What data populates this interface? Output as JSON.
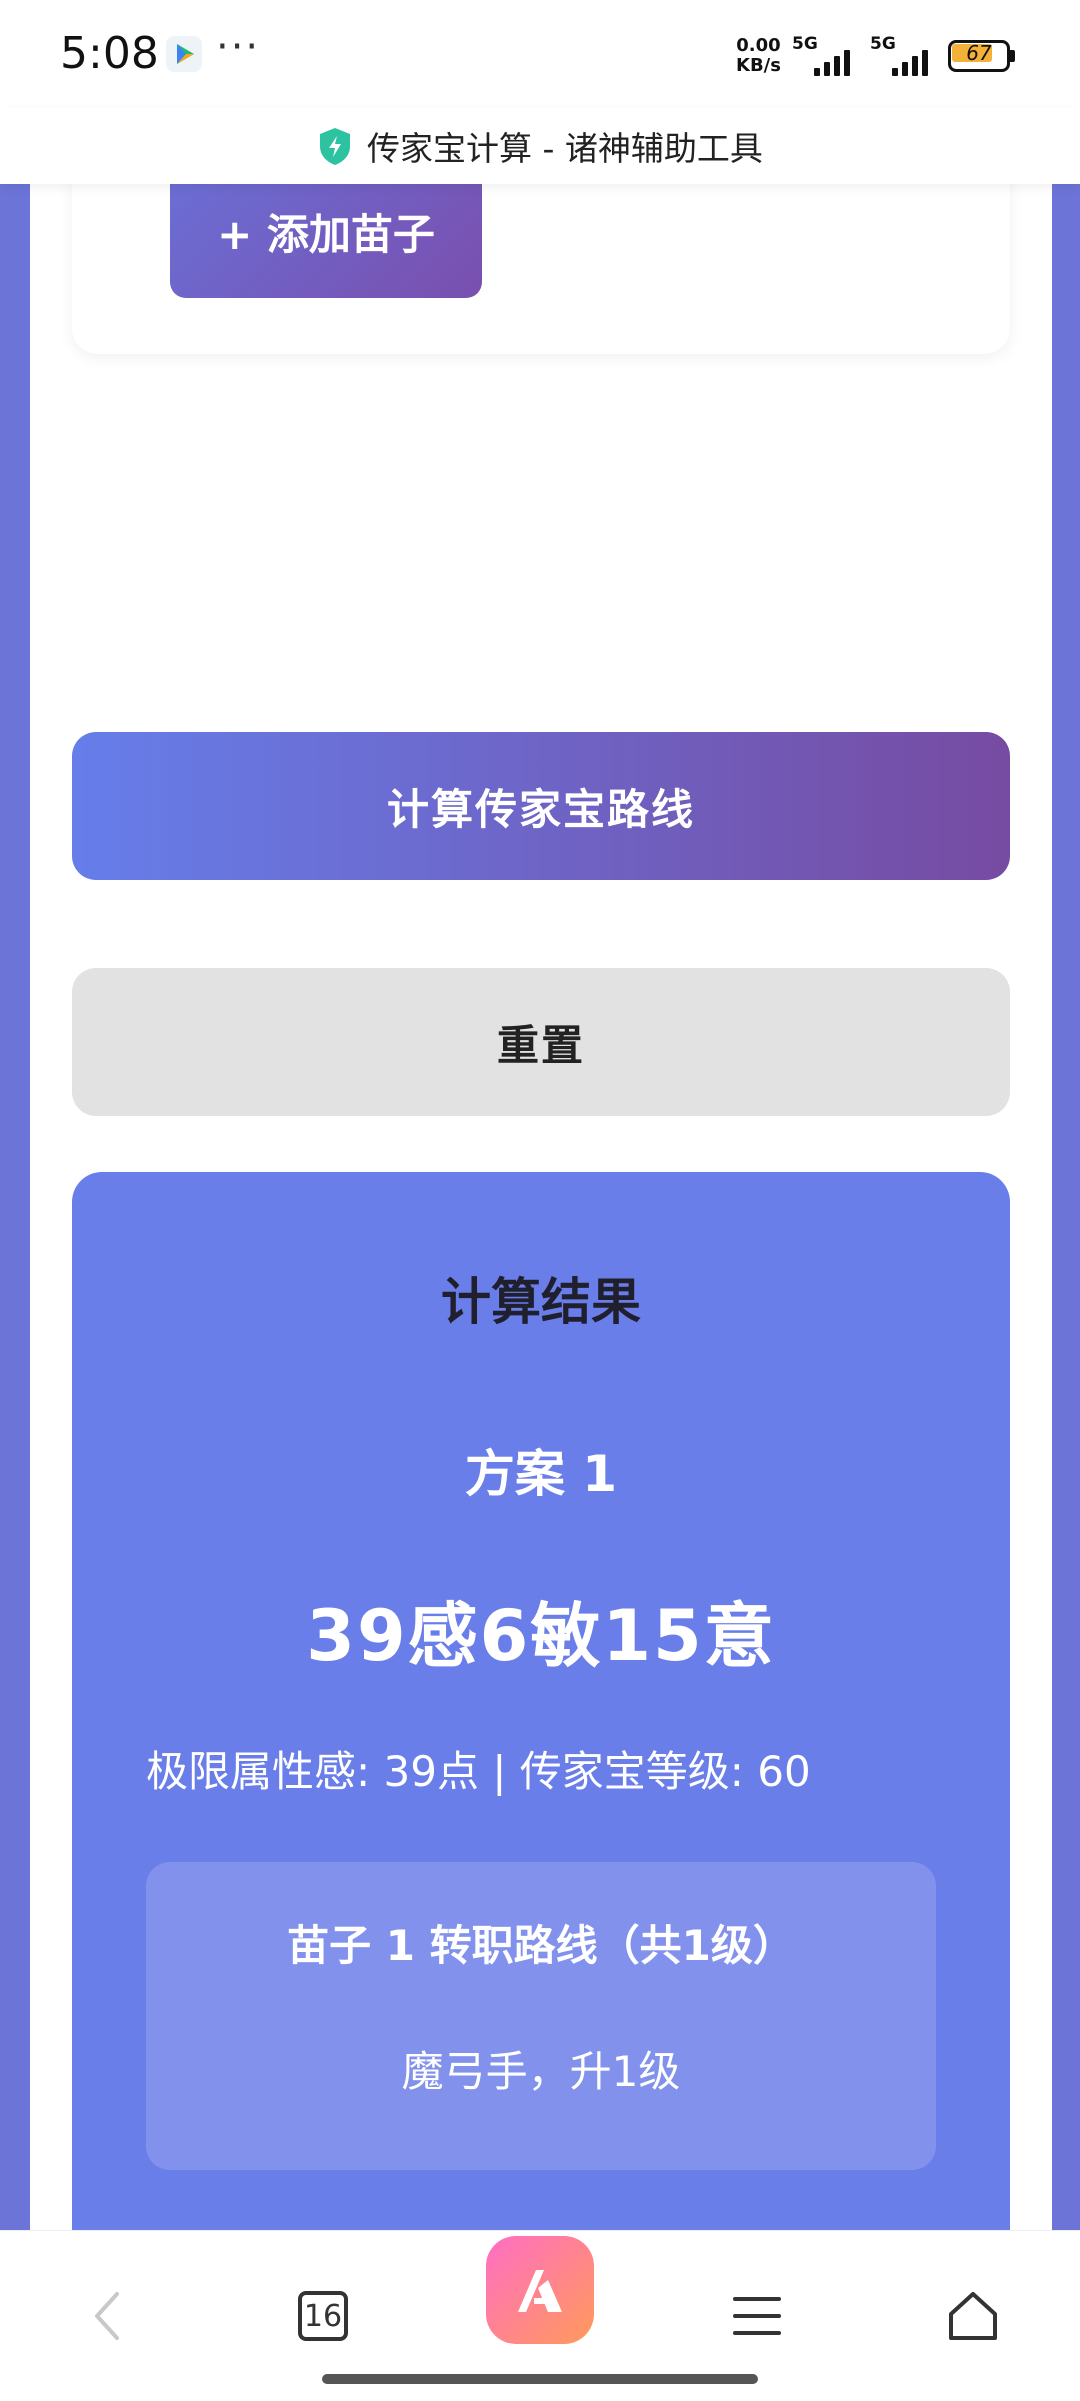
{
  "status_bar": {
    "time": "5:08",
    "more": "···",
    "network_speed": "0.00",
    "network_unit": "KB/s",
    "sim1": "5G",
    "sim2": "5G",
    "battery": "67"
  },
  "title_bar": {
    "title": "传家宝计算 - 诸神辅助工具",
    "icon": "shield-icon"
  },
  "top_panel": {
    "add_button": "+ 添加苗子"
  },
  "actions": {
    "calculate": "计算传家宝路线",
    "reset": "重置"
  },
  "result": {
    "title": "计算结果",
    "plan_name": "方案 1",
    "stats": "39感6敏15意",
    "info": "极限属性感: 39点 | 传家宝等级: 60",
    "route": {
      "title": "苗子 1 转职路线（共1级）",
      "detail": "魔弓手，升1级"
    },
    "attribute": {
      "label": "感",
      "value": "39"
    }
  },
  "bottom_nav": {
    "tab_count": "16",
    "back": "back-icon",
    "menu": "menu-icon",
    "home": "home-icon"
  },
  "colors": {
    "accent_start": "#667eea",
    "accent_end": "#764ba2",
    "result_bg": "#6a7ee9",
    "reset_bg": "#e2e2e2",
    "battery_fill": "#f3b13a"
  }
}
